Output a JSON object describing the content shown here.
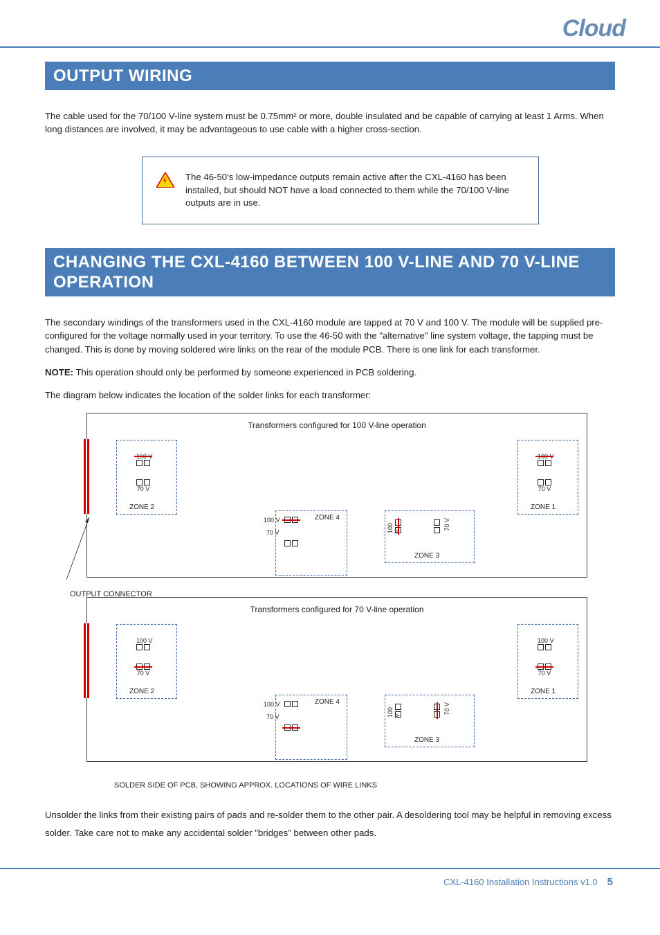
{
  "logo": "Cloud",
  "section1_title": "OUTPUT WIRING",
  "section1_para1": "The cable used for the 70/100 V-line system must be 0.75mm² or more, double insulated and be capable of carrying at least 1 Arms. When long distances are involved, it may be advantageous to use cable with a higher cross-section.",
  "note_text": "The 46-50's low-impedance outputs remain active after the CXL-4160 has been installed, but should NOT have a load connected to them while the 70/100 V-line outputs are in use.",
  "section2_title": "CHANGING THE CXL-4160 BETWEEN 100 V-LINE AND 70 V-LINE OPERATION",
  "section2_para1": "The secondary windings of the transformers used in the CXL-4160 module are tapped at 70 V and 100 V. The module will be supplied pre-configured for the voltage normally used in your territory. To use the 46-50 with the \"alternative\" line system voltage, the tapping must be changed. This is done by moving soldered wire links on the rear of the module PCB. There is one link for each transformer.",
  "section2_note_label": "NOTE:",
  "section2_note_body": " This operation should only be performed by someone experienced in PCB soldering.",
  "section2_para3": "The diagram below indicates the location of the solder links for each transformer:",
  "diagram1_title": "Transformers configured for 100 V-line operation",
  "diagram2_title": "Transformers configured for 70 V-line operation",
  "output_conn_label": "OUTPUT CONNECTOR",
  "solder_caption": "SOLDER SIDE OF PCB, SHOWING APPROX. LOCATIONS OF WIRE LINKS",
  "labels": {
    "v100": "100 V",
    "v70": "70 V",
    "z1": "ZONE 1",
    "z2": "ZONE 2",
    "z3": "ZONE 3",
    "z4": "ZONE 4"
  },
  "section2_para4": "Unsolder the links from their existing pairs of pads and re-solder them to the other pair. A desoldering tool may be helpful in removing excess solder. Take care not to make any accidental solder \"bridges\" between other pads.",
  "footer_text": "CXL-4160 Installation Instructions v1.0",
  "page_num": "5"
}
